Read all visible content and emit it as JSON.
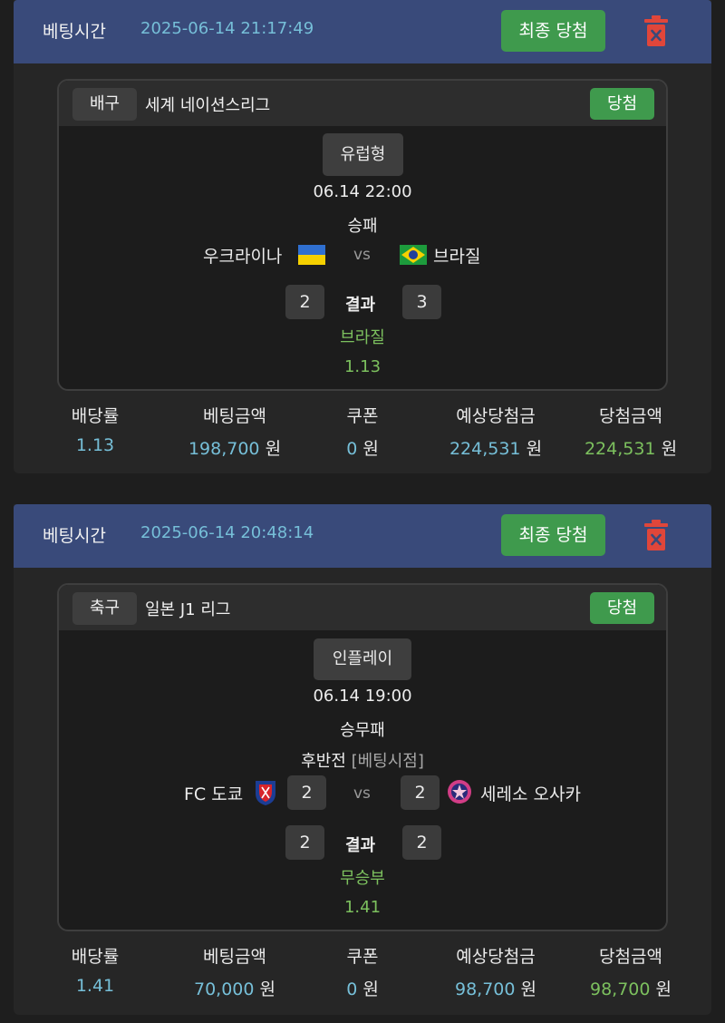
{
  "header_label": "베팅시간",
  "final_button": "최종 당첨",
  "win_tag": "당첨",
  "result_label": "결과",
  "vs": "vs",
  "stats_labels": [
    "배당률",
    "베팅금액",
    "쿠폰",
    "예상당첨금",
    "당첨금액"
  ],
  "unit": "원",
  "bets": [
    {
      "time": "2025-06-14 21:17:49",
      "sport": "배구",
      "league": "세계 네이션스리그",
      "type": "유럽형",
      "match_time": "06.14 22:00",
      "market": "승패",
      "home_team": "우크라이나",
      "away_team": "브라질",
      "home_score": "2",
      "away_score": "3",
      "pick": "브라질",
      "pick_odds": "1.13",
      "odds": "1.13",
      "amount": "198,700",
      "coupon": "0",
      "expected": "224,531",
      "won": "224,531"
    },
    {
      "time": "2025-06-14 20:48:14",
      "sport": "축구",
      "league": "일본 J1 리그",
      "type": "인플레이",
      "match_time": "06.14 19:00",
      "market": "승무패",
      "period": "후반전",
      "period_note": "[베팅시점]",
      "home_team": "FC 도쿄",
      "away_team": "세레소 오사카",
      "home_live": "2",
      "away_live": "2",
      "home_score": "2",
      "away_score": "2",
      "pick": "무승부",
      "pick_odds": "1.41",
      "odds": "1.41",
      "amount": "70,000",
      "coupon": "0",
      "expected": "98,700",
      "won": "98,700"
    }
  ],
  "colors": {
    "header_bg": "#394a7a",
    "green": "#3f9a4d",
    "win_text": "#7cc05e",
    "teal": "#76bfd8",
    "trash": "#e0463a"
  }
}
